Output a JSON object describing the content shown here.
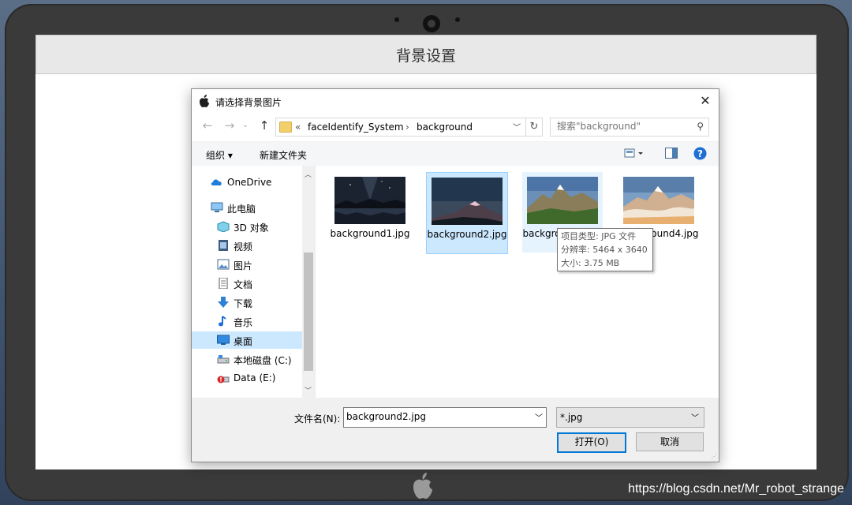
{
  "app": {
    "header_title": "背景设置",
    "watermark": "https://blog.csdn.net/Mr_robot_strange"
  },
  "dialog": {
    "title": "请选择背景图片",
    "nav": {
      "back": "←",
      "forward": "→",
      "recent": "⌄",
      "up": "↑"
    },
    "address": {
      "prefix": "«",
      "crumbs": [
        "faceIdentify_System",
        "background"
      ],
      "separator": "›"
    },
    "search": {
      "placeholder": "搜索\"background\""
    },
    "toolbar": {
      "organize": "组织 ▾",
      "new_folder": "新建文件夹"
    },
    "sidebar": {
      "items": [
        {
          "label": "OneDrive",
          "icon": "cloud-icon"
        },
        {
          "label": "此电脑",
          "icon": "computer-icon"
        },
        {
          "label": "3D 对象",
          "icon": "3d-objects-icon"
        },
        {
          "label": "视频",
          "icon": "video-icon"
        },
        {
          "label": "图片",
          "icon": "pictures-icon"
        },
        {
          "label": "文档",
          "icon": "documents-icon"
        },
        {
          "label": "下载",
          "icon": "download-icon"
        },
        {
          "label": "音乐",
          "icon": "music-icon"
        },
        {
          "label": "桌面",
          "icon": "desktop-icon",
          "selected": true
        },
        {
          "label": "本地磁盘 (C:)",
          "icon": "drive-c-icon"
        },
        {
          "label": "Data (E:)",
          "icon": "drive-e-icon"
        }
      ]
    },
    "files": [
      {
        "name": "background1.jpg",
        "state": "normal"
      },
      {
        "name": "background2.jpg",
        "state": "selected"
      },
      {
        "name": "background3.jpg",
        "state": "hover"
      },
      {
        "name": "background4.jpg",
        "state": "normal"
      }
    ],
    "tooltip": {
      "type": "项目类型: JPG 文件",
      "resolution": "分辨率: 5464 x 3640",
      "size": "大小: 3.75 MB"
    },
    "bottom": {
      "filename_label": "文件名(N):",
      "filename_value": "background2.jpg",
      "filter_value": "*.jpg",
      "open_label": "打开(O)",
      "cancel_label": "取消"
    }
  },
  "colors": {
    "selection": "#cce8ff",
    "accent": "#0078d7",
    "device": "#3a3a3a"
  }
}
